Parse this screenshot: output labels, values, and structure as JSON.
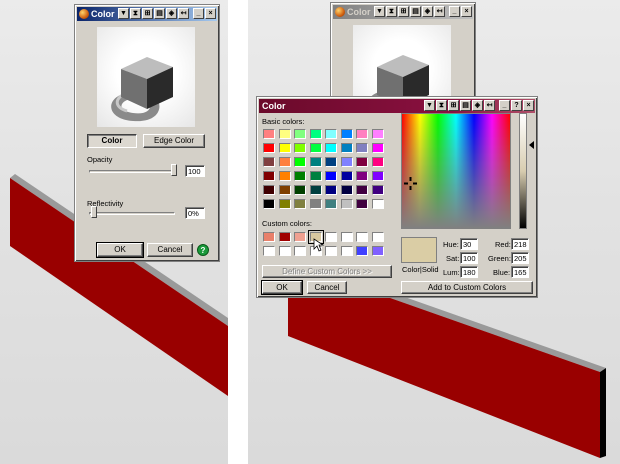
{
  "left_dialog": {
    "title": "Color",
    "title_buttons": [
      "▼",
      "⧗",
      "⊞",
      "▤",
      "◈",
      "↤",
      "_",
      "×"
    ],
    "color_button": "Color",
    "edge_color_button": "Edge Color",
    "opacity_label": "Opacity",
    "opacity_value": "100",
    "reflectivity_label": "Reflectivity",
    "reflectivity_value": "0%",
    "ok_button": "OK",
    "cancel_button": "Cancel",
    "help_icon": "?"
  },
  "bg_dialog": {
    "title": "Color",
    "title_buttons": [
      "▼",
      "⧗",
      "⊞",
      "▤",
      "◈",
      "↤",
      "_",
      "×"
    ]
  },
  "picker": {
    "title": "Color",
    "title_buttons": [
      "▼",
      "⧗",
      "⊞",
      "▤",
      "◈",
      "↤",
      "_",
      "?",
      "×"
    ],
    "basic_colors_label": "Basic colors:",
    "custom_colors_label": "Custom colors:",
    "define_custom_button": "Define Custom Colors >>",
    "ok_button": "OK",
    "cancel_button": "Cancel",
    "color_solid_label": "Color|Solid",
    "hue_label": "Hue:",
    "hue_value": "30",
    "sat_label": "Sat:",
    "sat_value": "100",
    "lum_label": "Lum:",
    "lum_value": "180",
    "red_label": "Red:",
    "red_value": "218",
    "green_label": "Green:",
    "green_value": "205",
    "blue_label": "Blue:",
    "blue_value": "165",
    "add_custom_button": "Add to Custom Colors",
    "selected_color": "#dacda5",
    "basic_colors": [
      [
        "#ff8080",
        "#ffff80",
        "#80ff80",
        "#00ff80",
        "#80ffff",
        "#0080ff",
        "#ff80c0",
        "#ff80ff"
      ],
      [
        "#ff0000",
        "#ffff00",
        "#80ff00",
        "#00ff40",
        "#00ffff",
        "#0080c0",
        "#8080c0",
        "#ff00ff"
      ],
      [
        "#804040",
        "#ff8040",
        "#00ff00",
        "#008080",
        "#004080",
        "#8080ff",
        "#800040",
        "#ff0080"
      ],
      [
        "#800000",
        "#ff8000",
        "#008000",
        "#008040",
        "#0000ff",
        "#0000a0",
        "#800080",
        "#8000ff"
      ],
      [
        "#400000",
        "#804000",
        "#004000",
        "#004040",
        "#000080",
        "#000040",
        "#400040",
        "#400080"
      ],
      [
        "#000000",
        "#808000",
        "#808040",
        "#808080",
        "#408080",
        "#c0c0c0",
        "#400040",
        "#ffffff"
      ]
    ],
    "custom_colors": [
      [
        "#e8806a",
        "#a00000",
        "#f0a090",
        "#d8c8a0",
        "#ffffff",
        "#ffffff",
        "#ffffff",
        "#ffffff"
      ],
      [
        "#ffffff",
        "#ffffff",
        "#ffffff",
        "#ffffff",
        "#ffffff",
        "#ffffff",
        "#4040ff",
        "#8060ff"
      ]
    ]
  },
  "colors": {
    "beam_red": "#990000",
    "title_blue": "#0a246a",
    "title_maroon": "#6b0a2a",
    "ui_face": "#d4d0c8"
  }
}
